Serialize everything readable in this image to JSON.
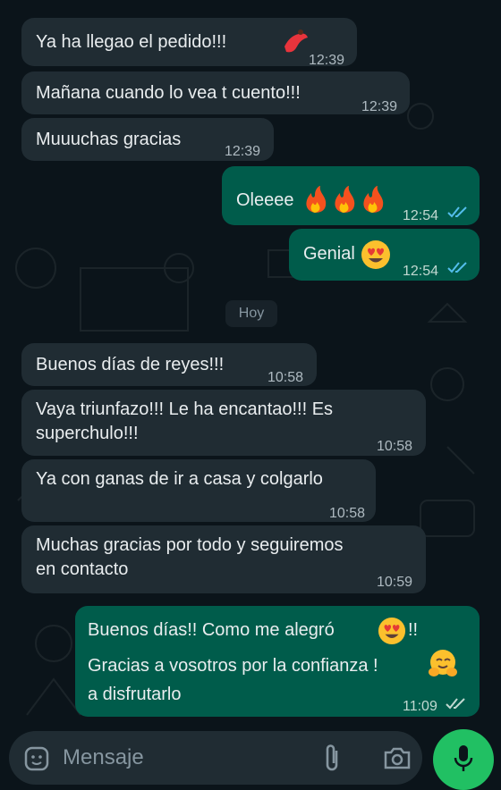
{
  "messages": [
    {
      "text": "Ya ha llegao el pedido!!!",
      "time": "12:39",
      "emoji": "dancer-emoji"
    },
    {
      "text": "Mañana cuando lo vea t cuento!!!",
      "time": "12:39"
    },
    {
      "text": "Muuuchas gracias",
      "time": "12:39"
    },
    {
      "text": "Oleeee",
      "time": "12:54",
      "emoji": "fire-emoji x3"
    },
    {
      "text": "Genial",
      "time": "12:54",
      "emoji": "heart-eyes-emoji"
    },
    {
      "text": "Buenos días de reyes!!!",
      "time": "10:58"
    },
    {
      "line1": "Vaya triunfazo!!! Le ha encantao!!! Es",
      "line2": "superchulo!!!",
      "time": "10:58"
    },
    {
      "text": "Ya con ganas de ir a casa y colgarlo",
      "time": "10:58"
    },
    {
      "line1": "Muchas gracias por todo y seguiremos",
      "line2": "en contacto",
      "time": "10:59"
    },
    {
      "line1a": "Buenos días!! Como me alegró",
      "line1b": "!!",
      "line2": "Gracias a vosotros por la confianza !",
      "line3": "a disfrutarlo",
      "time": "11:09"
    }
  ],
  "day_chip": "Hoy",
  "input": {
    "placeholder": "Mensaje"
  },
  "colors": {
    "incoming": "#202c33",
    "outgoing": "#005c4b",
    "background": "#0b141a",
    "mic": "#21c063",
    "read_ticks": "#53bdeb"
  },
  "icons": [
    "sticker-icon",
    "attach-icon",
    "camera-icon",
    "mic-icon",
    "double-check-icon"
  ]
}
